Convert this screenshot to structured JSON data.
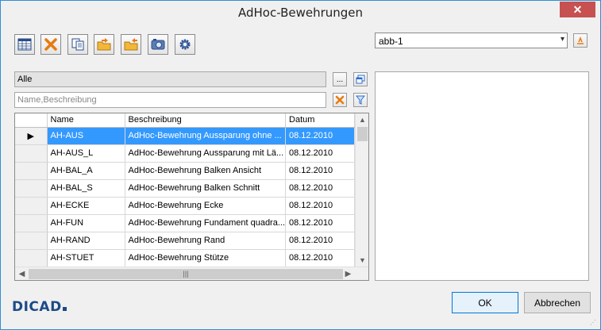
{
  "window": {
    "title": "AdHoc-Bewehrungen",
    "close_label": "✕"
  },
  "toolbar": {
    "buttons": [
      {
        "icon": "table-icon"
      },
      {
        "icon": "delete-icon"
      },
      {
        "icon": "copy-icon"
      },
      {
        "icon": "folder-export-icon"
      },
      {
        "icon": "folder-import-icon"
      },
      {
        "icon": "camera-icon"
      },
      {
        "icon": "settings-icon"
      }
    ]
  },
  "combo": {
    "value": "abb-1",
    "arrow": "▾"
  },
  "filter": {
    "category_value": "Alle",
    "browse_label": "...",
    "search_placeholder": "Name,Beschreibung"
  },
  "grid": {
    "columns": [
      "",
      "Name",
      "Beschreibung",
      "Datum"
    ],
    "rows": [
      {
        "marker": "▶",
        "name": "AH-AUS",
        "desc": "AdHoc-Bewehrung Aussparung ohne ...",
        "date": "08.12.2010",
        "selected": true
      },
      {
        "marker": "",
        "name": "AH-AUS_L",
        "desc": "AdHoc-Bewehrung Aussparung mit Lä...",
        "date": "08.12.2010"
      },
      {
        "marker": "",
        "name": "AH-BAL_A",
        "desc": "AdHoc-Bewehrung Balken Ansicht",
        "date": "08.12.2010"
      },
      {
        "marker": "",
        "name": "AH-BAL_S",
        "desc": "AdHoc-Bewehrung Balken Schnitt",
        "date": "08.12.2010"
      },
      {
        "marker": "",
        "name": "AH-ECKE",
        "desc": "AdHoc-Bewehrung Ecke",
        "date": "08.12.2010"
      },
      {
        "marker": "",
        "name": "AH-FUN",
        "desc": "AdHoc-Bewehrung Fundament quadra...",
        "date": "08.12.2010"
      },
      {
        "marker": "",
        "name": "AH-RAND",
        "desc": "AdHoc-Bewehrung Rand",
        "date": "08.12.2010"
      },
      {
        "marker": "",
        "name": "AH-STUET",
        "desc": "AdHoc-Bewehrung Stütze",
        "date": "08.12.2010"
      }
    ]
  },
  "logo": {
    "text": "DICAD"
  },
  "buttons": {
    "ok": "OK",
    "cancel": "Abbrechen"
  }
}
